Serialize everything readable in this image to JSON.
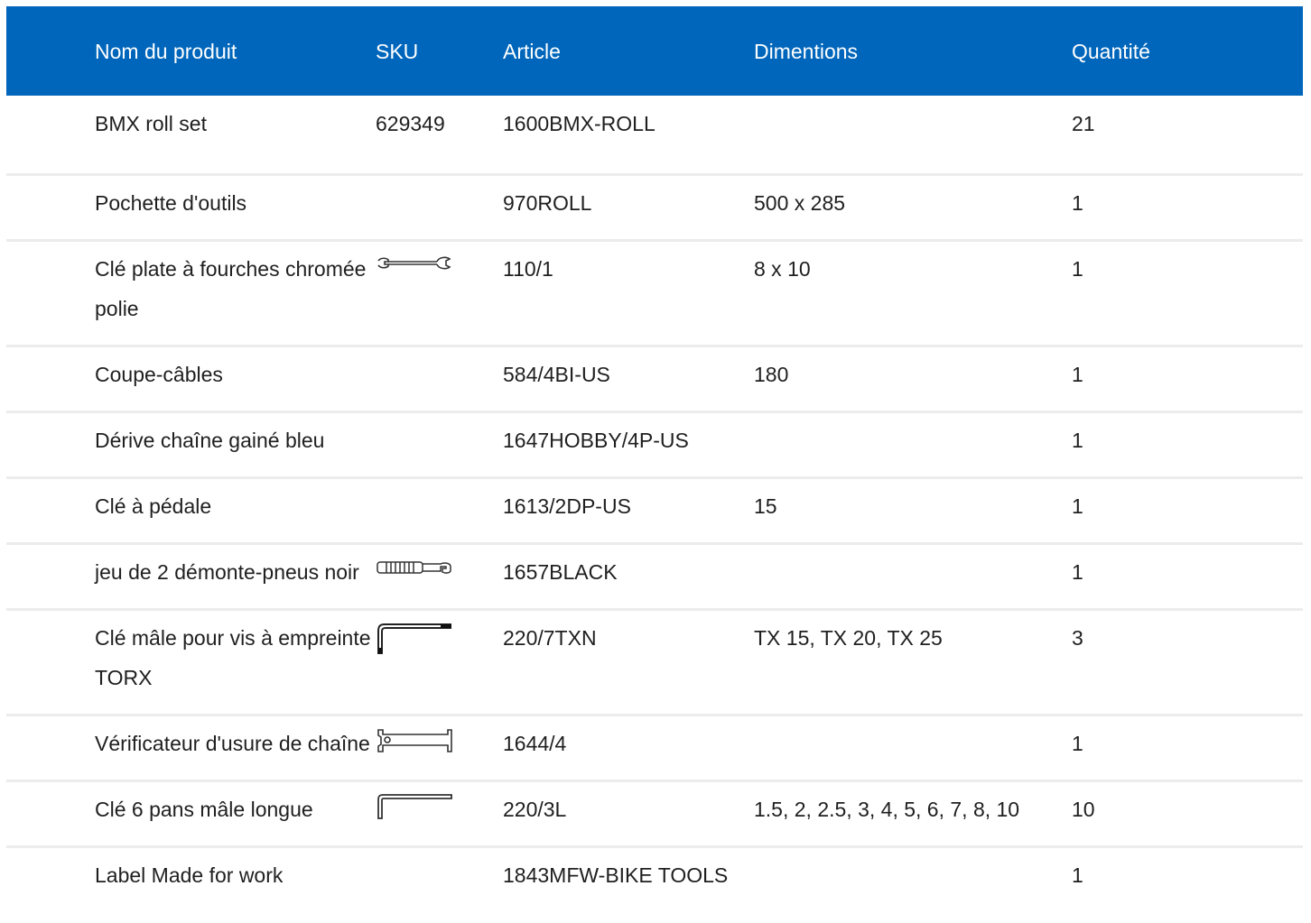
{
  "headers": {
    "product": "Nom du produit",
    "sku": "SKU",
    "article": "Article",
    "dimensions": "Dimentions",
    "quantity": "Quantité"
  },
  "rows": [
    {
      "name": "BMX roll set",
      "sku": "629349",
      "icon": "",
      "article": "1600BMX-ROLL",
      "dimensions": "",
      "quantity": "21"
    },
    {
      "name": "Pochette d'outils",
      "sku": "",
      "icon": "",
      "article": "970ROLL",
      "dimensions": "500 x 285",
      "quantity": "1"
    },
    {
      "name": "Clé plate à fourches chromée polie",
      "sku": "",
      "icon": "open-end-wrench-icon",
      "article": "110/1",
      "dimensions": "8 x 10",
      "quantity": "1"
    },
    {
      "name": "Coupe-câbles",
      "sku": "",
      "icon": "",
      "article": "584/4BI-US",
      "dimensions": "180",
      "quantity": "1"
    },
    {
      "name": "Dérive chaîne gainé bleu",
      "sku": "",
      "icon": "",
      "article": "1647HOBBY/4P-US",
      "dimensions": "",
      "quantity": "1"
    },
    {
      "name": "Clé à pédale",
      "sku": "",
      "icon": "",
      "article": "1613/2DP-US",
      "dimensions": "15",
      "quantity": "1"
    },
    {
      "name": "jeu de 2 démonte-pneus noir",
      "sku": "",
      "icon": "tire-lever-icon",
      "article": "1657BLACK",
      "dimensions": "",
      "quantity": "1"
    },
    {
      "name": "Clé mâle pour vis à empreinte TORX",
      "sku": "",
      "icon": "torx-key-icon",
      "article": "220/7TXN",
      "dimensions": "TX 15, TX 20, TX 25",
      "quantity": "3"
    },
    {
      "name": "Vérificateur d'usure de chaîne",
      "sku": "",
      "icon": "chain-checker-icon",
      "article": "1644/4",
      "dimensions": "",
      "quantity": "1"
    },
    {
      "name": "Clé 6 pans mâle longue",
      "sku": "",
      "icon": "hex-key-icon",
      "article": "220/3L",
      "dimensions": "1.5, 2, 2.5, 3, 4, 5, 6, 7, 8, 10",
      "quantity": "10"
    },
    {
      "name": "Label Made for work",
      "sku": "",
      "icon": "",
      "article": "1843MFW-BIKE TOOLS",
      "dimensions": "",
      "quantity": "1"
    }
  ],
  "colors": {
    "header_bg": "#0066bb",
    "header_text": "#ffffff",
    "row_divider": "#ececec"
  }
}
